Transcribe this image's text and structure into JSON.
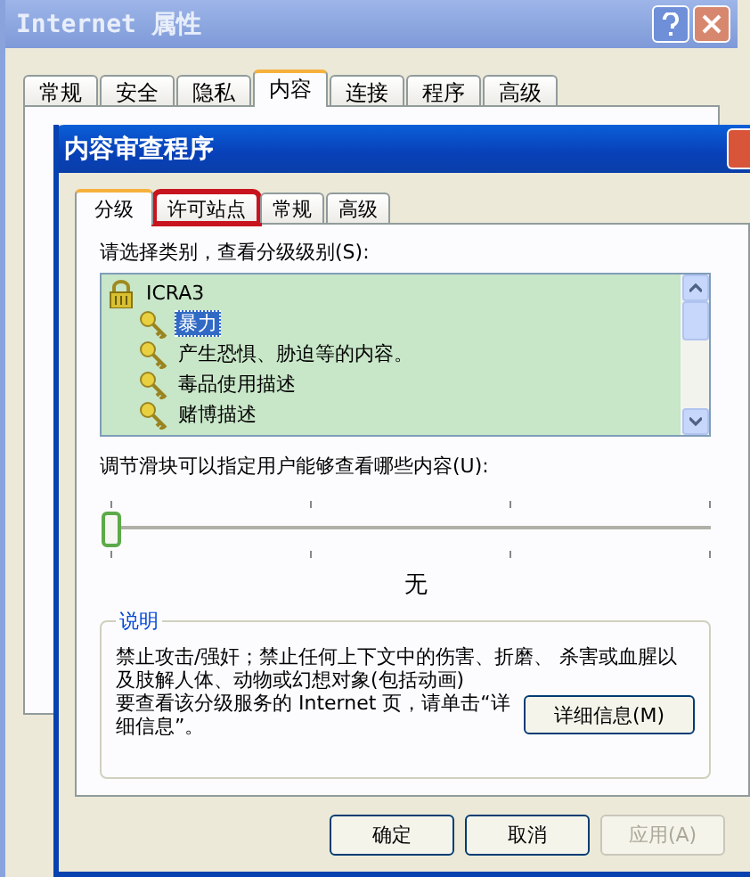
{
  "outer_window": {
    "title": "Internet 属性",
    "active": false,
    "tabs": [
      {
        "label": "常规",
        "selected": false
      },
      {
        "label": "安全",
        "selected": false
      },
      {
        "label": "隐私",
        "selected": false
      },
      {
        "label": "内容",
        "selected": true
      },
      {
        "label": "连接",
        "selected": false
      },
      {
        "label": "程序",
        "selected": false
      },
      {
        "label": "高级",
        "selected": false
      }
    ]
  },
  "dialog": {
    "title": "内容审查程序",
    "active": true,
    "tabs": [
      {
        "label": "分级",
        "selected": true,
        "highlighted": false
      },
      {
        "label": "许可站点",
        "selected": false,
        "highlighted": true
      },
      {
        "label": "常规",
        "selected": false,
        "highlighted": false
      },
      {
        "label": "高级",
        "selected": false,
        "highlighted": false
      }
    ],
    "category_label": "请选择类别，查看分级级别(S):",
    "tree": [
      {
        "label": "ICRA3",
        "kind": "lock",
        "selected": false,
        "children": [
          {
            "label": "暴力",
            "kind": "key",
            "selected": true
          },
          {
            "label": "产生恐惧、胁迫等的内容。",
            "kind": "key",
            "selected": false
          },
          {
            "label": "毒品使用描述",
            "kind": "key",
            "selected": false
          },
          {
            "label": "赌博描述",
            "kind": "key",
            "selected": false
          }
        ]
      }
    ],
    "slider_label": "调节滑块可以指定用户能够查看哪些内容(U):",
    "slider": {
      "level": 0,
      "reading": "无"
    },
    "description": {
      "title": "说明",
      "text": "禁止攻击/强奸；禁止任何上下文中的伤害、折磨、 杀害或血腥以及肢解人体、动物或幻想对象(包括动画)",
      "more_text": "要查看该分级服务的 Internet 页，请单击“详细信息”。",
      "more_button": "详细信息(M)"
    },
    "buttons": [
      {
        "label": "确定",
        "disabled": false
      },
      {
        "label": "取消",
        "disabled": false
      },
      {
        "label": "应用(A)",
        "disabled": true
      }
    ]
  }
}
